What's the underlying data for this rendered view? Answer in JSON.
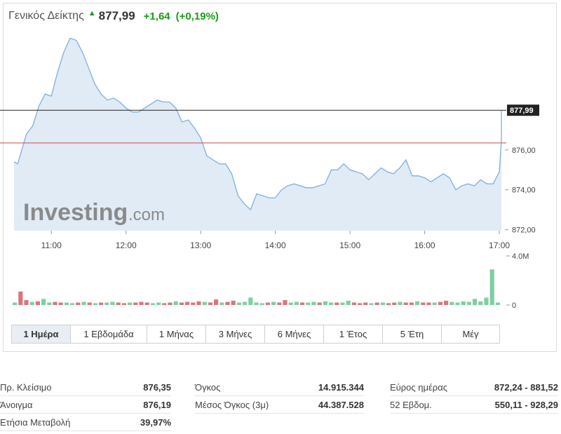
{
  "header": {
    "title": "Γενικός Δείκτης",
    "price": "877,99",
    "change": "+1,64",
    "change_pct": "(+0,19%)",
    "up_color": "#1a9c1a",
    "arrow_icon": "triangle-up-icon"
  },
  "watermark": {
    "brand": "Investing",
    "suffix": ".com"
  },
  "chart_data": {
    "type": "line",
    "x_time_range": [
      "10:30",
      "17:10"
    ],
    "x_ticks": [
      "11:00",
      "12:00",
      "13:00",
      "14:00",
      "15:00",
      "16:00",
      "17:00"
    ],
    "y_ticks": [
      "872,00",
      "874,00",
      "876,00"
    ],
    "ylim": [
      871.95,
      881.9
    ],
    "last_value": 877.99,
    "last_value_label": "877,99",
    "prev_close": 876.35,
    "series": [
      {
        "values": [
          [
            "10:30",
            875.4
          ],
          [
            "10:33",
            875.3
          ],
          [
            "10:40",
            876.8
          ],
          [
            "10:45",
            877.2
          ],
          [
            "10:50",
            878.2
          ],
          [
            "10:55",
            878.8
          ],
          [
            "11:00",
            878.7
          ],
          [
            "11:05",
            879.9
          ],
          [
            "11:10",
            880.9
          ],
          [
            "11:15",
            881.6
          ],
          [
            "11:20",
            881.5
          ],
          [
            "11:25",
            880.9
          ],
          [
            "11:30",
            880.1
          ],
          [
            "11:35",
            879.3
          ],
          [
            "11:40",
            878.8
          ],
          [
            "11:45",
            878.5
          ],
          [
            "11:50",
            878.6
          ],
          [
            "11:55",
            878.4
          ],
          [
            "12:00",
            878.1
          ],
          [
            "12:05",
            877.9
          ],
          [
            "12:10",
            877.9
          ],
          [
            "12:15",
            878.1
          ],
          [
            "12:20",
            878.3
          ],
          [
            "12:25",
            878.5
          ],
          [
            "12:30",
            878.4
          ],
          [
            "12:35",
            878.4
          ],
          [
            "12:40",
            878.1
          ],
          [
            "12:45",
            877.4
          ],
          [
            "12:50",
            877.5
          ],
          [
            "12:55",
            877.1
          ],
          [
            "13:00",
            876.6
          ],
          [
            "13:05",
            875.7
          ],
          [
            "13:10",
            875.5
          ],
          [
            "13:15",
            875.3
          ],
          [
            "13:20",
            875.3
          ],
          [
            "13:25",
            874.8
          ],
          [
            "13:30",
            873.7
          ],
          [
            "13:35",
            873.3
          ],
          [
            "13:40",
            873.0
          ],
          [
            "13:45",
            873.8
          ],
          [
            "13:50",
            873.7
          ],
          [
            "13:55",
            873.6
          ],
          [
            "14:00",
            873.6
          ],
          [
            "14:05",
            874.0
          ],
          [
            "14:10",
            874.2
          ],
          [
            "14:15",
            874.3
          ],
          [
            "14:20",
            874.2
          ],
          [
            "14:25",
            874.1
          ],
          [
            "14:30",
            874.1
          ],
          [
            "14:35",
            874.2
          ],
          [
            "14:40",
            874.3
          ],
          [
            "14:45",
            875.0
          ],
          [
            "14:50",
            875.0
          ],
          [
            "14:55",
            875.3
          ],
          [
            "15:00",
            875.0
          ],
          [
            "15:05",
            874.9
          ],
          [
            "15:10",
            874.8
          ],
          [
            "15:15",
            874.5
          ],
          [
            "15:20",
            874.8
          ],
          [
            "15:25",
            875.1
          ],
          [
            "15:30",
            874.9
          ],
          [
            "15:35",
            874.8
          ],
          [
            "15:40",
            875.1
          ],
          [
            "15:45",
            875.5
          ],
          [
            "15:50",
            874.7
          ],
          [
            "15:55",
            874.7
          ],
          [
            "16:00",
            874.6
          ],
          [
            "16:05",
            874.4
          ],
          [
            "16:10",
            874.6
          ],
          [
            "16:15",
            874.8
          ],
          [
            "16:20",
            874.6
          ],
          [
            "16:25",
            874.0
          ],
          [
            "16:30",
            874.2
          ],
          [
            "16:35",
            874.3
          ],
          [
            "16:40",
            874.2
          ],
          [
            "16:45",
            874.5
          ],
          [
            "16:50",
            874.3
          ],
          [
            "16:55",
            874.3
          ],
          [
            "17:00",
            874.9
          ],
          [
            "17:03",
            876.5
          ],
          [
            "17:07",
            876.5
          ],
          [
            "17:10",
            876.5
          ],
          [
            "17:12",
            877.99
          ]
        ]
      }
    ],
    "volume": {
      "max_label": "4.0M",
      "zero_label": "0",
      "max_value": 4.0,
      "bars": [
        [
          0.2,
          "up"
        ],
        [
          1.1,
          "down"
        ],
        [
          0.4,
          "down"
        ],
        [
          0.25,
          "up"
        ],
        [
          0.3,
          "down"
        ],
        [
          0.5,
          "up"
        ],
        [
          0.2,
          "up"
        ],
        [
          0.25,
          "down"
        ],
        [
          0.2,
          "down"
        ],
        [
          0.2,
          "up"
        ],
        [
          0.15,
          "up"
        ],
        [
          0.2,
          "down"
        ],
        [
          0.25,
          "up"
        ],
        [
          0.2,
          "down"
        ],
        [
          0.15,
          "up"
        ],
        [
          0.2,
          "down"
        ],
        [
          0.2,
          "up"
        ],
        [
          0.25,
          "up"
        ],
        [
          0.2,
          "down"
        ],
        [
          0.15,
          "down"
        ],
        [
          0.2,
          "up"
        ],
        [
          0.2,
          "down"
        ],
        [
          0.25,
          "down"
        ],
        [
          0.2,
          "down"
        ],
        [
          0.15,
          "up"
        ],
        [
          0.2,
          "up"
        ],
        [
          0.15,
          "down"
        ],
        [
          0.2,
          "down"
        ],
        [
          0.3,
          "up"
        ],
        [
          0.2,
          "down"
        ],
        [
          0.25,
          "down"
        ],
        [
          0.2,
          "down"
        ],
        [
          0.3,
          "down"
        ],
        [
          0.25,
          "up"
        ],
        [
          0.2,
          "down"
        ],
        [
          0.45,
          "down"
        ],
        [
          0.2,
          "up"
        ],
        [
          0.25,
          "down"
        ],
        [
          0.35,
          "down"
        ],
        [
          0.2,
          "up"
        ],
        [
          0.25,
          "up"
        ],
        [
          0.6,
          "up"
        ],
        [
          0.2,
          "up"
        ],
        [
          0.15,
          "up"
        ],
        [
          0.2,
          "down"
        ],
        [
          0.25,
          "up"
        ],
        [
          0.2,
          "down"
        ],
        [
          0.4,
          "down"
        ],
        [
          0.2,
          "up"
        ],
        [
          0.25,
          "up"
        ],
        [
          0.2,
          "down"
        ],
        [
          0.2,
          "up"
        ],
        [
          0.25,
          "up"
        ],
        [
          0.2,
          "down"
        ],
        [
          0.3,
          "up"
        ],
        [
          0.2,
          "up"
        ],
        [
          0.2,
          "down"
        ],
        [
          0.2,
          "up"
        ],
        [
          0.35,
          "up"
        ],
        [
          0.2,
          "down"
        ],
        [
          0.15,
          "down"
        ],
        [
          0.2,
          "down"
        ],
        [
          0.15,
          "up"
        ],
        [
          0.2,
          "down"
        ],
        [
          0.2,
          "up"
        ],
        [
          0.15,
          "down"
        ],
        [
          0.2,
          "down"
        ],
        [
          0.25,
          "up"
        ],
        [
          0.2,
          "down"
        ],
        [
          0.2,
          "down"
        ],
        [
          0.3,
          "up"
        ],
        [
          0.2,
          "down"
        ],
        [
          0.2,
          "down"
        ],
        [
          0.2,
          "up"
        ],
        [
          0.25,
          "down"
        ],
        [
          0.35,
          "down"
        ],
        [
          0.25,
          "up"
        ],
        [
          0.2,
          "up"
        ],
        [
          0.3,
          "up"
        ],
        [
          0.25,
          "up"
        ],
        [
          0.5,
          "up"
        ],
        [
          0.3,
          "up"
        ],
        [
          0.6,
          "up"
        ],
        [
          2.9,
          "up"
        ],
        [
          0.2,
          "up"
        ]
      ]
    }
  },
  "tabs": [
    {
      "label": "1 Ημέρα",
      "active": true
    },
    {
      "label": "1 Εβδομάδα",
      "active": false
    },
    {
      "label": "1 Μήνας",
      "active": false
    },
    {
      "label": "3 Μήνες",
      "active": false
    },
    {
      "label": "6 Μήνες",
      "active": false
    },
    {
      "label": "1 Έτος",
      "active": false
    },
    {
      "label": "5 Έτη",
      "active": false
    },
    {
      "label": "Μέγ",
      "active": false
    }
  ],
  "stats": {
    "col1": [
      {
        "label": "Πρ. Κλείσιμο",
        "value": "876,35"
      },
      {
        "label": "Άνοιγμα",
        "value": "876,19"
      },
      {
        "label": "Ετήσια Μεταβολή",
        "value": "39,97%"
      }
    ],
    "col2": [
      {
        "label": "Όγκος",
        "value": "14.915.344"
      },
      {
        "label": "Μέσος Όγκος (3μ)",
        "value": "44.387.528"
      }
    ],
    "col3": [
      {
        "label": "Εύρος ημέρας",
        "value": "872,24 - 881,52"
      },
      {
        "label": "52 Εβδομ.",
        "value": "550,11 - 928,29"
      }
    ]
  },
  "colors": {
    "line": "#7eb0de",
    "area": "#e1ebf6",
    "prev_close_line": "#c84a4a",
    "last_line": "#222222",
    "vol_up": "#7fcf9f",
    "vol_down": "#d9767a"
  }
}
